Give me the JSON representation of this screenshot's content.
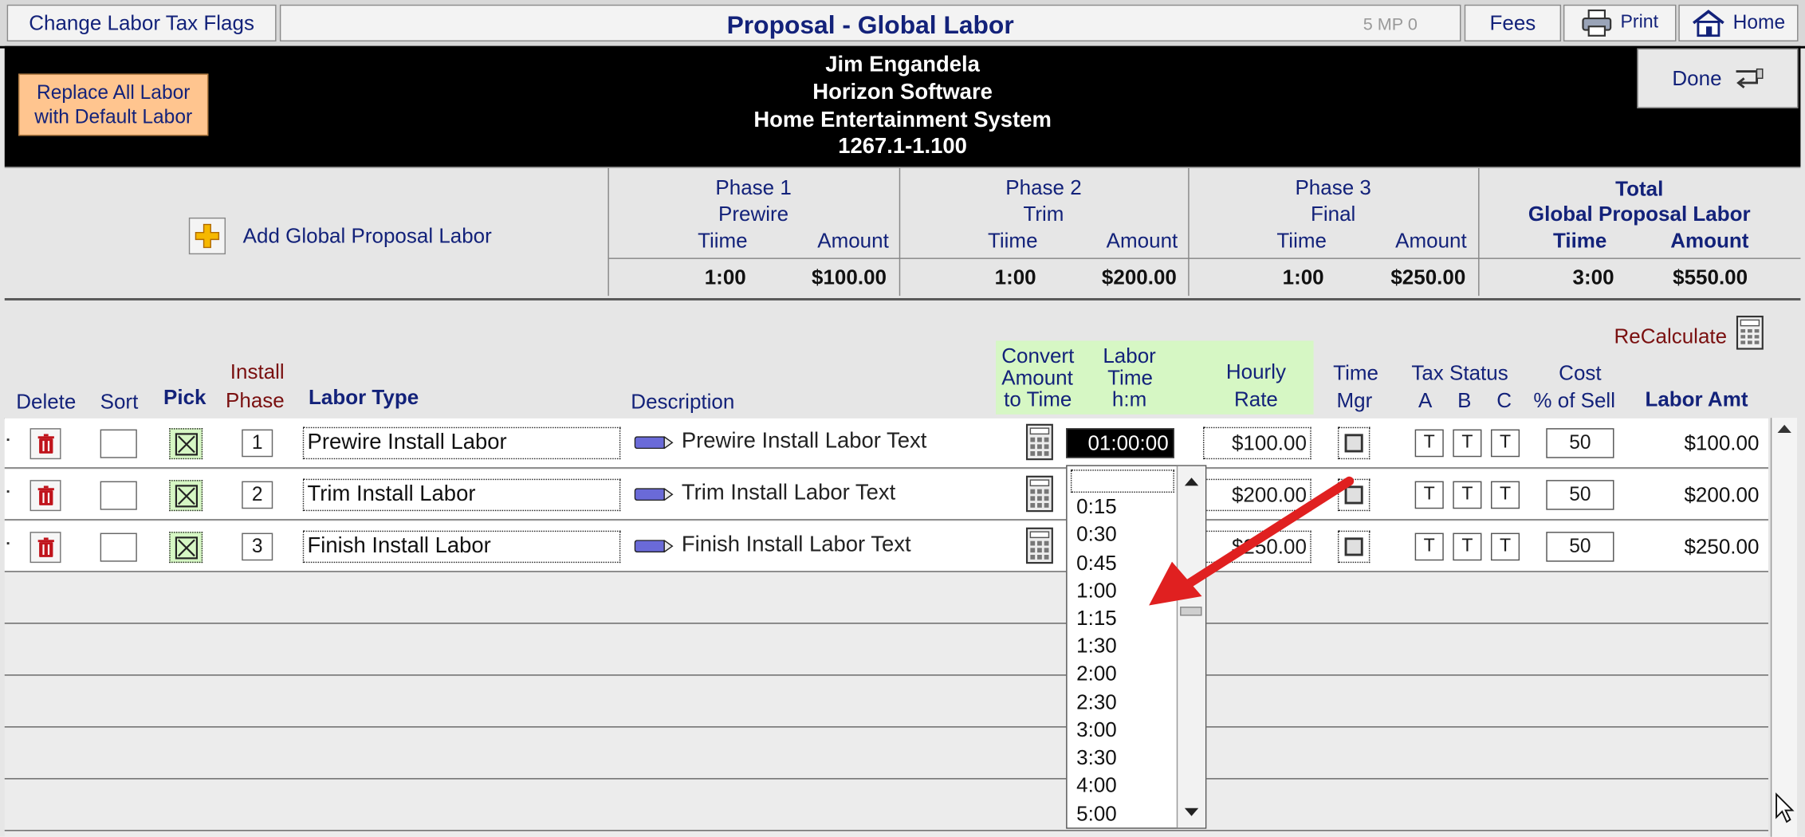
{
  "topbar": {
    "change_tax_flags": "Change Labor Tax Flags",
    "title": "Proposal - Global Labor",
    "mp_status": "5  MP 0",
    "fees": "Fees",
    "print": "Print",
    "home": "Home"
  },
  "header": {
    "client_name": "Jim Engandela",
    "company": "Horizon Software",
    "project": "Home Entertainment System",
    "proposal_number": "1267.1-1.100",
    "replace_line1": "Replace All Labor",
    "replace_line2": "with Default Labor",
    "done": "Done"
  },
  "summary": {
    "add_label": "Add Global Proposal Labor",
    "time_label": "Tiime",
    "amount_label": "Amount",
    "phases": [
      {
        "name": "Phase 1",
        "sub": "Prewire",
        "time": "1:00",
        "amount": "$100.00"
      },
      {
        "name": "Phase 2",
        "sub": "Trim",
        "time": "1:00",
        "amount": "$200.00"
      },
      {
        "name": "Phase 3",
        "sub": "Final",
        "time": "1:00",
        "amount": "$250.00"
      }
    ],
    "total": {
      "title": "Total",
      "sub": "Global Proposal Labor",
      "time_label": "Tiime",
      "amount_label": "Amount",
      "time": "3:00",
      "amount": "$550.00"
    }
  },
  "columns": {
    "delete": "Delete",
    "sort": "Sort",
    "pick": "Pick",
    "install": "Install",
    "phase": "Phase",
    "labor_type": "Labor Type",
    "description": "Description",
    "convert1": "Convert",
    "convert2": "Amount",
    "convert3": "to Time",
    "labor1": "Labor",
    "labor2": "Time",
    "labor3": "h:m",
    "hourly1": "Hourly",
    "hourly2": "Rate",
    "time1": "Time",
    "time2": "Mgr",
    "tax": "Tax Status",
    "tax_a": "A",
    "tax_b": "B",
    "tax_c": "C",
    "cost1": "Cost",
    "cost2": "% of Sell",
    "labor_amt": "Labor Amt",
    "recalculate": "ReCalculate"
  },
  "rows": [
    {
      "phase": "1",
      "type": "Prewire Install Labor",
      "description": "Prewire Install Labor Text",
      "labor_time": "01:00:00",
      "rate": "$100.00",
      "tax_a": "T",
      "tax_b": "T",
      "tax_c": "T",
      "cost": "50",
      "amount": "$100.00"
    },
    {
      "phase": "2",
      "type": "Trim Install Labor",
      "description": "Trim Install Labor Text",
      "labor_time": "",
      "rate": "$200.00",
      "tax_a": "T",
      "tax_b": "T",
      "tax_c": "T",
      "cost": "50",
      "amount": "$200.00"
    },
    {
      "phase": "3",
      "type": "Finish Install Labor",
      "description": "Finish Install Labor Text",
      "labor_time": "",
      "rate": "$250.00",
      "tax_a": "T",
      "tax_b": "T",
      "tax_c": "T",
      "cost": "50",
      "amount": "$250.00"
    }
  ],
  "dropdown": {
    "options": [
      "0:15",
      "0:30",
      "0:45",
      "1:00",
      "1:15",
      "1:30",
      "2:00",
      "2:30",
      "3:00",
      "3:30",
      "4:00",
      "5:00"
    ]
  },
  "icons": {
    "trash": "trash-icon",
    "pencil": "pencil-icon",
    "calculator": "calculator-icon",
    "printer": "printer-icon",
    "home": "home-icon",
    "done": "return-arrow-icon",
    "add": "plus-icon",
    "annotation": "red-arrow-annotation"
  },
  "colors": {
    "title_text": "#13227a",
    "header_bg": "#000000",
    "replace_btn": "#ffc58f",
    "green_header": "#d6f7c4",
    "recalc_text": "#7a1010",
    "arrow": "#e02020"
  }
}
